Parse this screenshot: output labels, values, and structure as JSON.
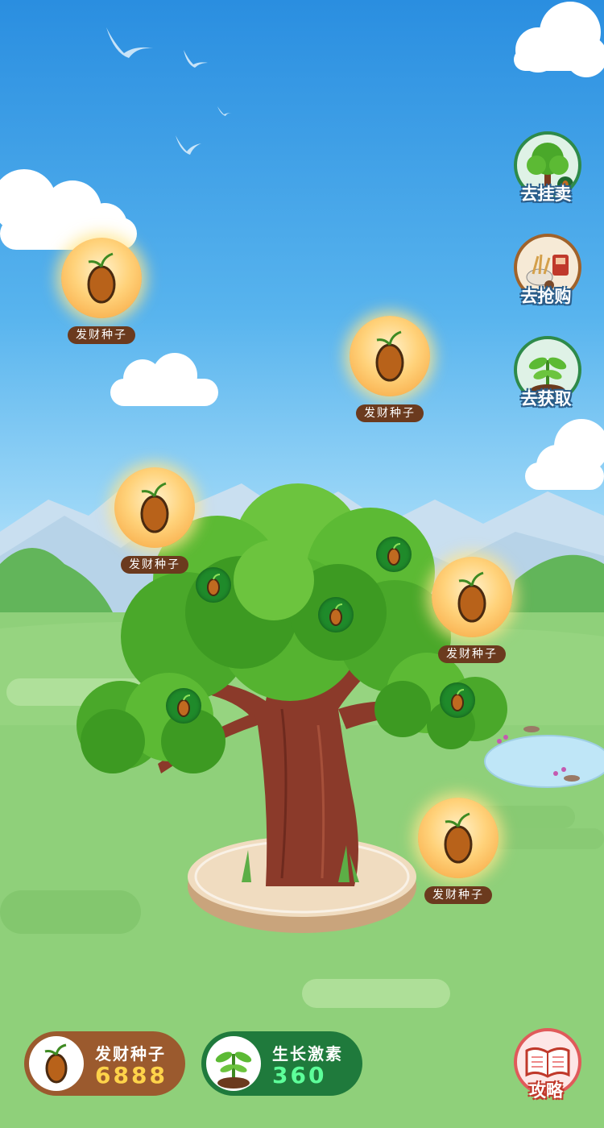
{
  "side_buttons": [
    {
      "label": "去挂卖",
      "icon": "tree-icon"
    },
    {
      "label": "去抢购",
      "icon": "shopping-cart-icon"
    },
    {
      "label": "去获取",
      "icon": "sprout-icon"
    }
  ],
  "seed_label": "发财种子",
  "seeds_collectible": [
    {
      "label": "发财种子"
    },
    {
      "label": "发财种子"
    },
    {
      "label": "发财种子"
    },
    {
      "label": "发财种子"
    },
    {
      "label": "发财种子"
    }
  ],
  "bottom": {
    "seeds": {
      "name": "发财种子",
      "value": "6888",
      "icon": "seed-icon"
    },
    "hormone": {
      "name": "生长激素",
      "value": "360",
      "icon": "sprout-icon"
    },
    "guide": {
      "label": "攻略",
      "icon": "book-icon"
    }
  },
  "colors": {
    "seed_pill": "#9b5a2e",
    "hormone_pill": "#1f7a3c",
    "seed_value": "#ffd34a",
    "hormone_value": "#5dff9a"
  }
}
